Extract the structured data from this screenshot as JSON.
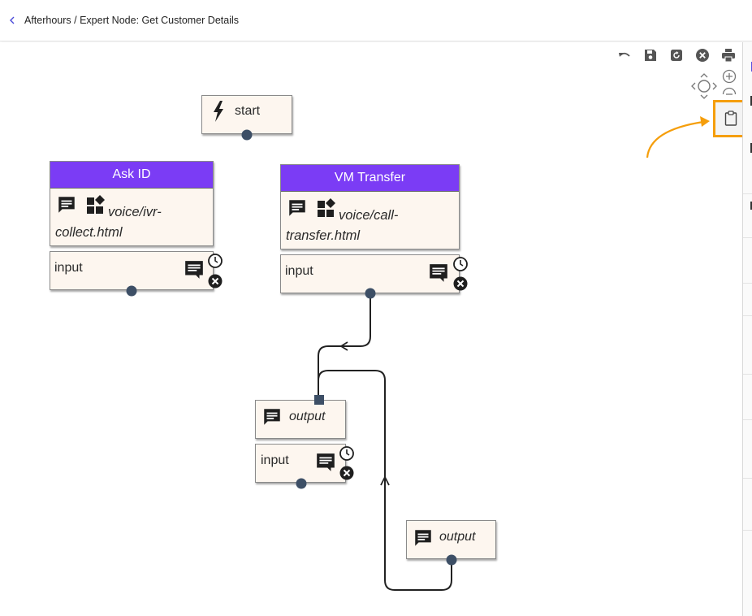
{
  "header": {
    "breadcrumb": "Afterhours / Expert Node: Get Customer Details"
  },
  "nodes": {
    "start": {
      "label": "start"
    },
    "ask_id": {
      "title": "Ask ID",
      "template": "voice/ivr-collect.html",
      "template_line1": "voice/ivr-",
      "template_line2": "collect.html",
      "input_label": "input"
    },
    "vm_transfer": {
      "title": "VM Transfer",
      "template": "voice/call-transfer.html",
      "template_line1": "voice/call-",
      "template_line2": "transfer.html",
      "input_label": "input"
    },
    "output_node": {
      "output_label": "output",
      "input_label": "input"
    },
    "output_node_2": {
      "output_label": "output"
    }
  },
  "toolbar": {
    "icons": [
      "undo-icon",
      "save-icon",
      "reload-icon",
      "close-icon",
      "print-icon",
      "pan-icon",
      "zoom-in-icon",
      "zoom-out-icon",
      "clipboard-icon"
    ]
  },
  "colors": {
    "node_header": "#7b3cf5",
    "node_body": "#fdf6ef",
    "highlight": "#f59e0b",
    "port": "#3d4f66"
  }
}
